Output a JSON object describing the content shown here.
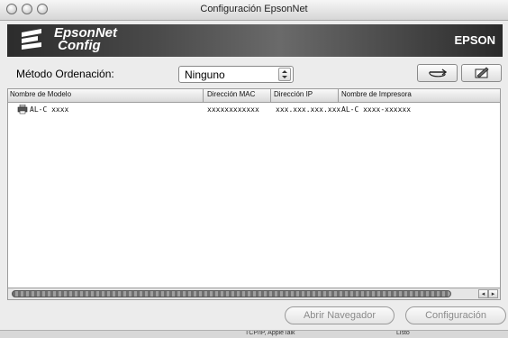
{
  "window": {
    "title": "Configuración EpsonNet"
  },
  "banner": {
    "product_line1": "EpsonNet",
    "product_line2": "Config",
    "brand": "EPSON"
  },
  "sort": {
    "label": "Método Ordenación:",
    "selected": "Ninguno"
  },
  "toolbar": {
    "refresh_icon": "refresh-icon",
    "edit_icon": "edit-icon"
  },
  "table": {
    "columns": [
      "Nombre de Modelo",
      "Dirección MAC",
      "Dirección IP",
      "Nombre de Impresora"
    ],
    "rows": [
      {
        "model": "AL-C xxxx",
        "mac": "xxxxxxxxxxxx",
        "ip": "xxx.xxx.xxx.xxx",
        "printer": "AL-C xxxx-xxxxxx"
      }
    ]
  },
  "buttons": {
    "browser": "Abrir Navegador",
    "config": "Configuración"
  },
  "status": {
    "protocol": "TCP/IP, AppleTalk",
    "state": "Listo"
  }
}
